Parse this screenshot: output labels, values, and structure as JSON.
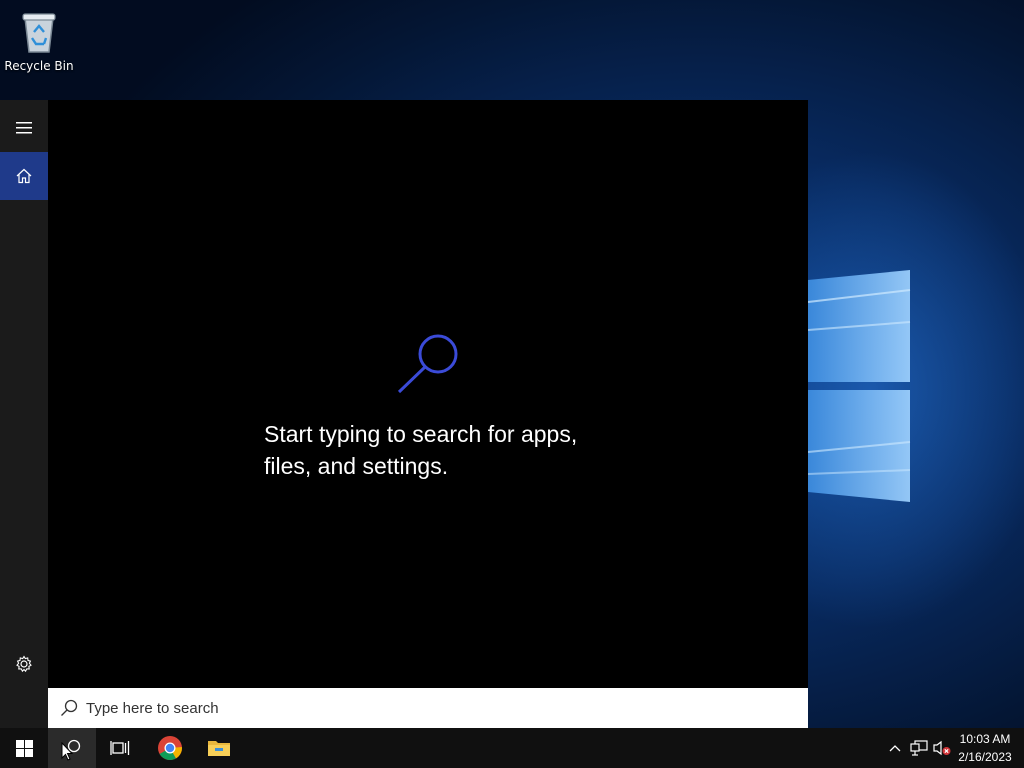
{
  "desktop": {
    "icons": [
      {
        "label": "Recycle Bin",
        "icon": "recycle-bin-icon"
      }
    ]
  },
  "start_panel": {
    "rail": {
      "menu_icon": "hamburger-menu-icon",
      "home_icon": "home-icon",
      "settings_icon": "gear-icon"
    },
    "hint": {
      "icon": "search-magnifier-icon",
      "line1": "Start typing to search for apps,",
      "line2": "files, and settings."
    },
    "search": {
      "placeholder": "Type here to search",
      "icon": "search-icon"
    }
  },
  "taskbar": {
    "buttons": [
      {
        "name": "start",
        "icon": "windows-logo-icon"
      },
      {
        "name": "search",
        "icon": "search-icon",
        "active": true
      },
      {
        "name": "task-view",
        "icon": "task-view-icon"
      },
      {
        "name": "chrome",
        "icon": "chrome-icon"
      },
      {
        "name": "file-explorer",
        "icon": "folder-icon"
      }
    ],
    "tray": {
      "icons": [
        "chevron-up-icon",
        "network-icon",
        "volume-muted-icon"
      ],
      "time": "10:03 AM",
      "date": "2/16/2023"
    }
  },
  "colors": {
    "accent": "#1f3a8a",
    "hint_icon": "#3b4bd8",
    "taskbar": "#101010",
    "rail": "#1b1b1b"
  }
}
